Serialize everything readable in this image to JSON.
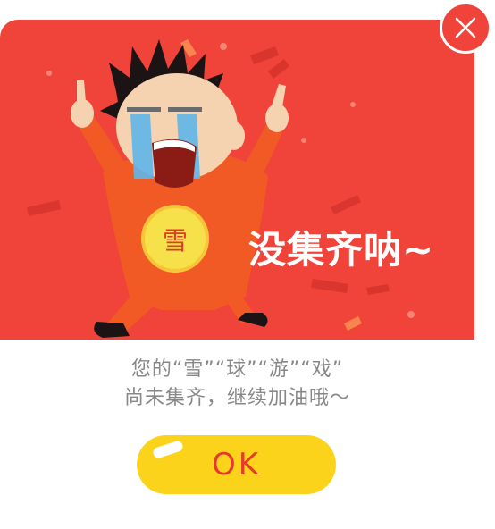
{
  "dialog": {
    "banner_title": "没集齐呐~",
    "badge_character": "雪",
    "message_line1": "您的“雪”“球”“游”“戏”",
    "message_line2": "尚未集齐，继续加油哦～",
    "ok_label": "OK"
  },
  "colors": {
    "banner_red": "#f0433a",
    "ok_yellow": "#fbd31b",
    "ok_text_red": "#e53a2c",
    "message_gray": "#888888"
  },
  "icons": {
    "close": "close-icon",
    "illustration": "crying-boy-illustration"
  }
}
